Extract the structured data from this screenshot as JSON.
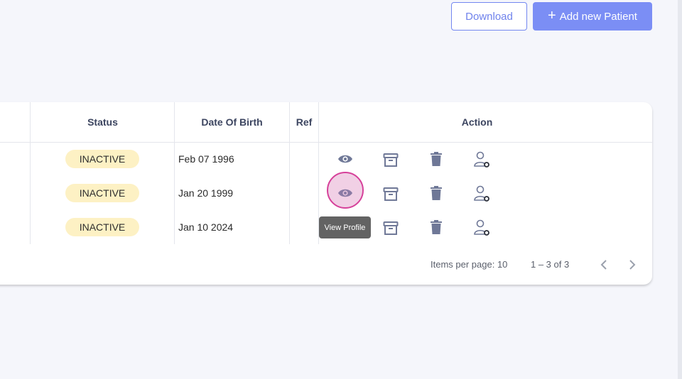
{
  "toolbar": {
    "download_label": "Download",
    "add_label": "Add new Patient"
  },
  "table": {
    "columns": [
      "Status",
      "Date Of Birth",
      "Ref",
      "Action"
    ],
    "rows": [
      {
        "status": "INACTIVE",
        "dob": "Feb 07 1996",
        "ref": ""
      },
      {
        "status": "INACTIVE",
        "dob": "Jan 20 1999",
        "ref": ""
      },
      {
        "status": "INACTIVE",
        "dob": "Jan 10 2024",
        "ref": ""
      }
    ],
    "row_actions": [
      "eye-icon",
      "archive-icon",
      "trash-icon",
      "user-settings-icon"
    ]
  },
  "tooltip": {
    "text": "View Profile"
  },
  "pagination": {
    "items_per_page": "Items per page: 10",
    "range": "1 – 3 of 3"
  },
  "colors": {
    "accent": "#7b8ef5",
    "badge_bg": "#fdf1c4",
    "icon": "#6f7897",
    "focus_ring": "#d6419a"
  }
}
